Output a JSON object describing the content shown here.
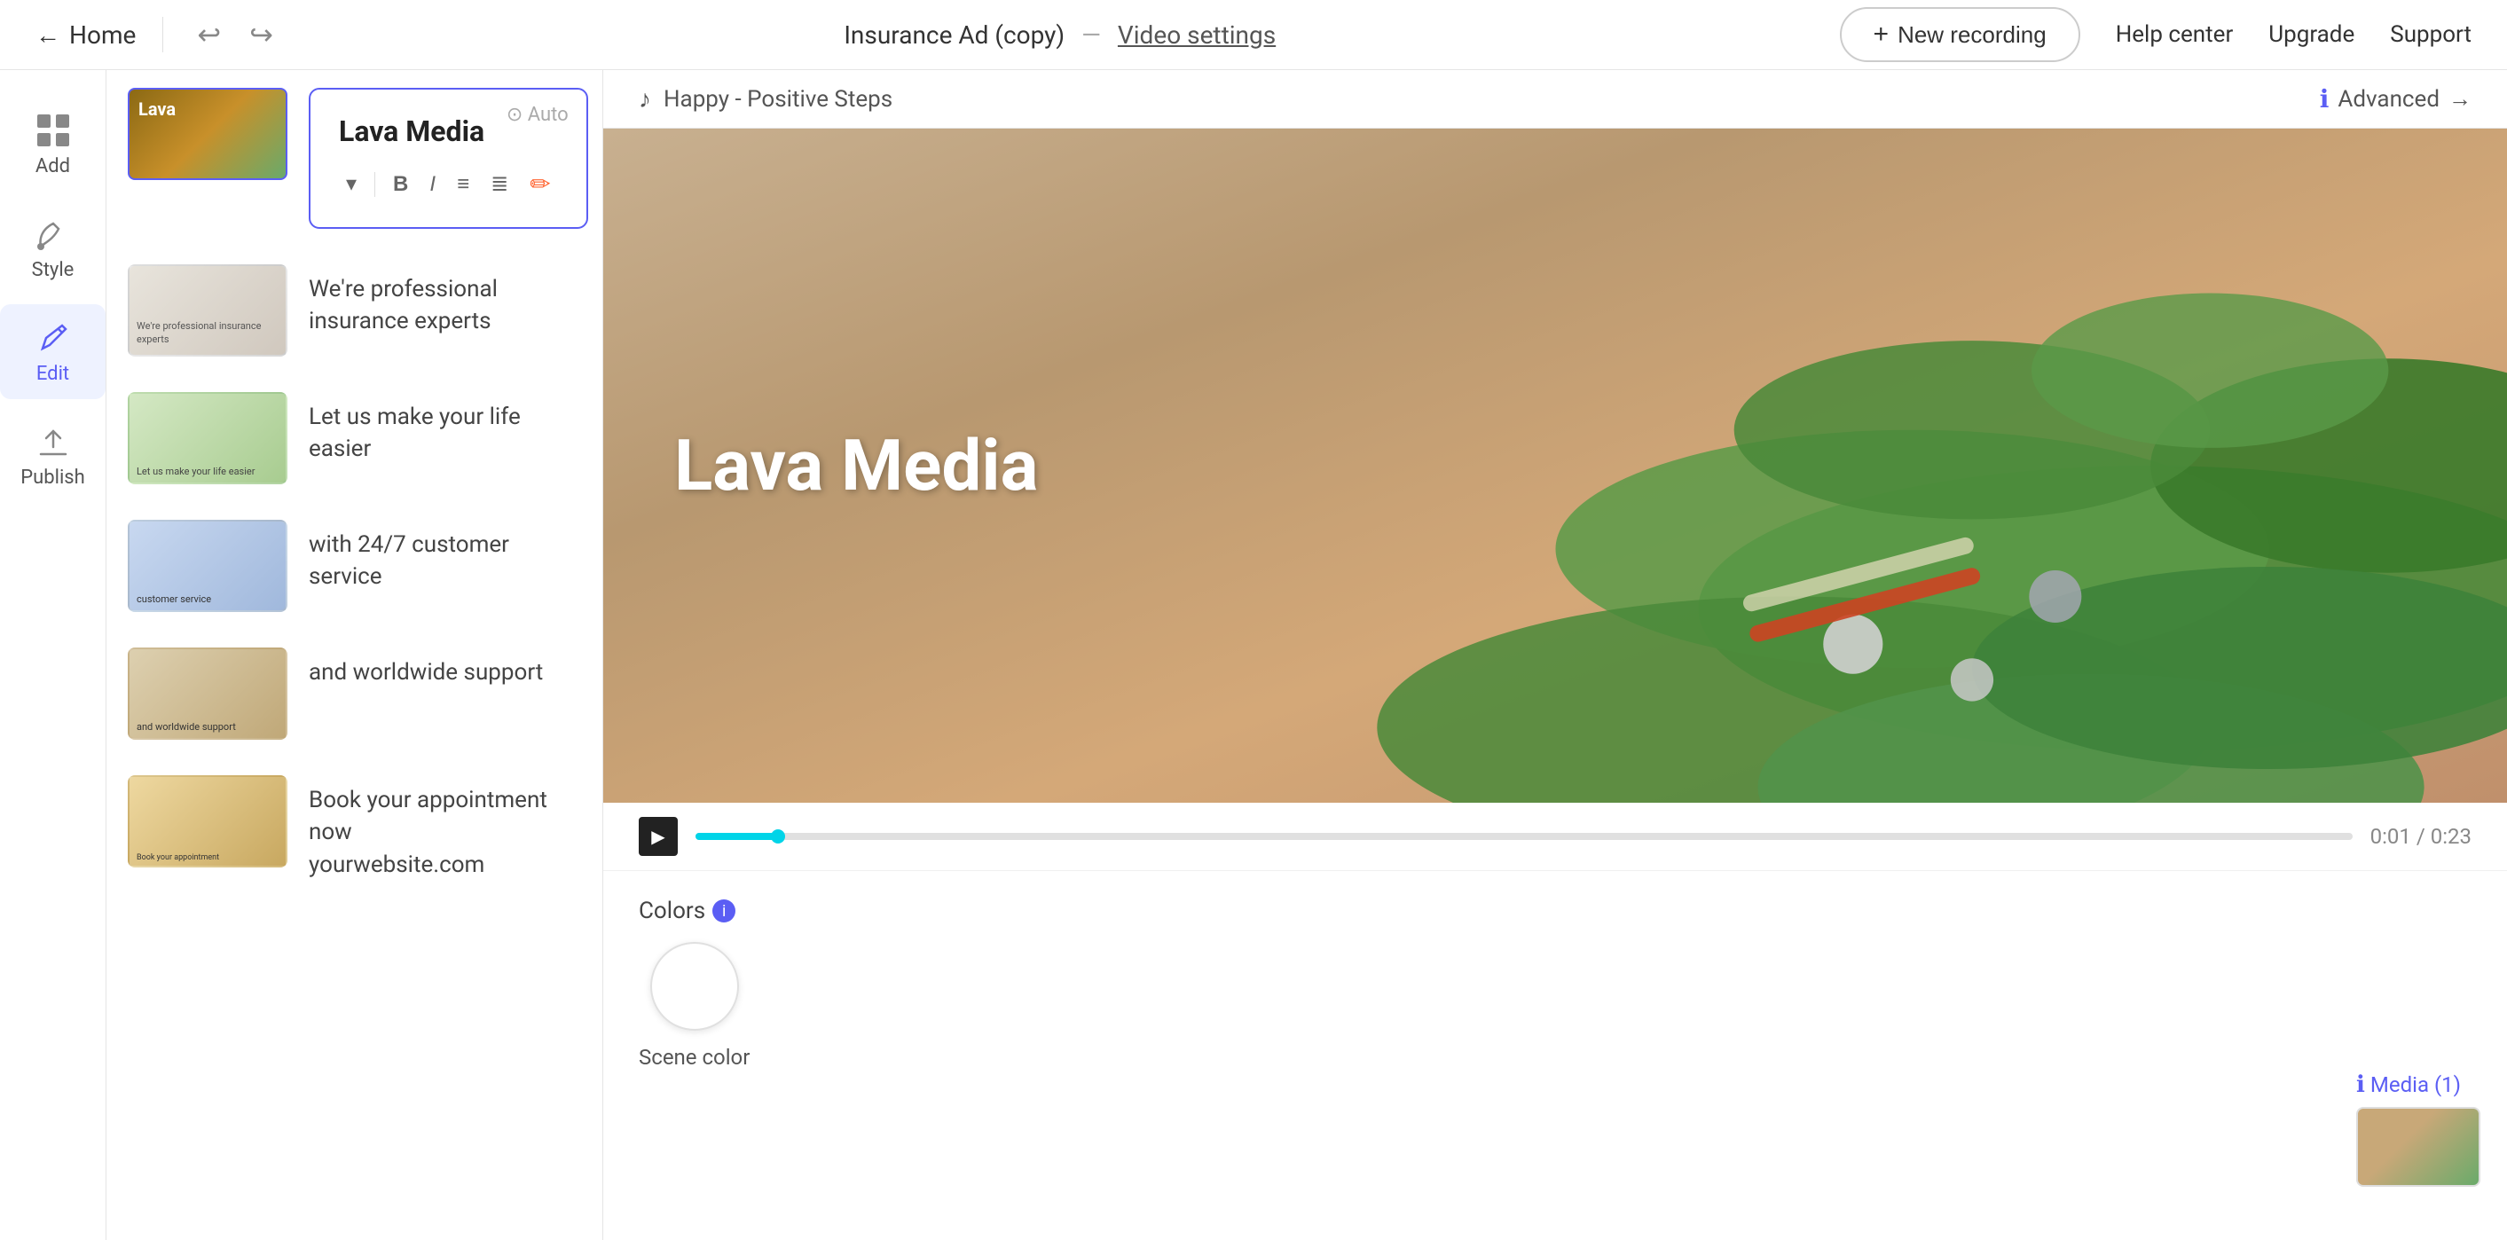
{
  "nav": {
    "home_label": "Home",
    "undo_icon": "↩",
    "redo_icon": "↪",
    "project_name": "Insurance Ad (copy)",
    "separator": "—",
    "video_settings_label": "Video settings",
    "new_recording_label": "New recording",
    "help_center_label": "Help center",
    "upgrade_label": "Upgrade",
    "support_label": "Support"
  },
  "sidebar": {
    "items": [
      {
        "id": "add",
        "label": "Add",
        "icon": "grid"
      },
      {
        "id": "style",
        "label": "Style",
        "icon": "brush"
      },
      {
        "id": "edit",
        "label": "Edit",
        "icon": "pencil",
        "active": true
      },
      {
        "id": "publish",
        "label": "Publish",
        "icon": "upload"
      }
    ]
  },
  "slides": [
    {
      "id": 1,
      "title": "Lava Media",
      "editing": true,
      "thumb_type": "lava",
      "auto_label": "Auto"
    },
    {
      "id": 2,
      "text": "We're professional insurance experts",
      "thumb_type": "insurance"
    },
    {
      "id": 3,
      "text": "Let us make your life easier",
      "thumb_type": "chart"
    },
    {
      "id": 4,
      "text": "with 24/7 customer service",
      "thumb_type": "customer"
    },
    {
      "id": 5,
      "text": "and worldwide support",
      "thumb_type": "worldwide"
    },
    {
      "id": 6,
      "text": "Book your appointment now\nyourwebsite.com",
      "thumb_type": "book"
    }
  ],
  "toolbar": {
    "style_dropdown": "▾",
    "bold": "B",
    "italic": "I",
    "bullet": "≡",
    "numbered": "≣",
    "color_icon": "🖊"
  },
  "music": {
    "icon": "♪",
    "track": "Happy - Positive Steps",
    "advanced_label": "Advanced",
    "info_icon": "ℹ",
    "arrow": "→"
  },
  "preview": {
    "title": "Lava Media",
    "time_current": "0:01",
    "time_total": "0:23",
    "time_display": "0:01 / 0:23"
  },
  "settings": {
    "colors_label": "Colors",
    "scene_color_label": "Scene color",
    "media_label": "Media (1)"
  }
}
